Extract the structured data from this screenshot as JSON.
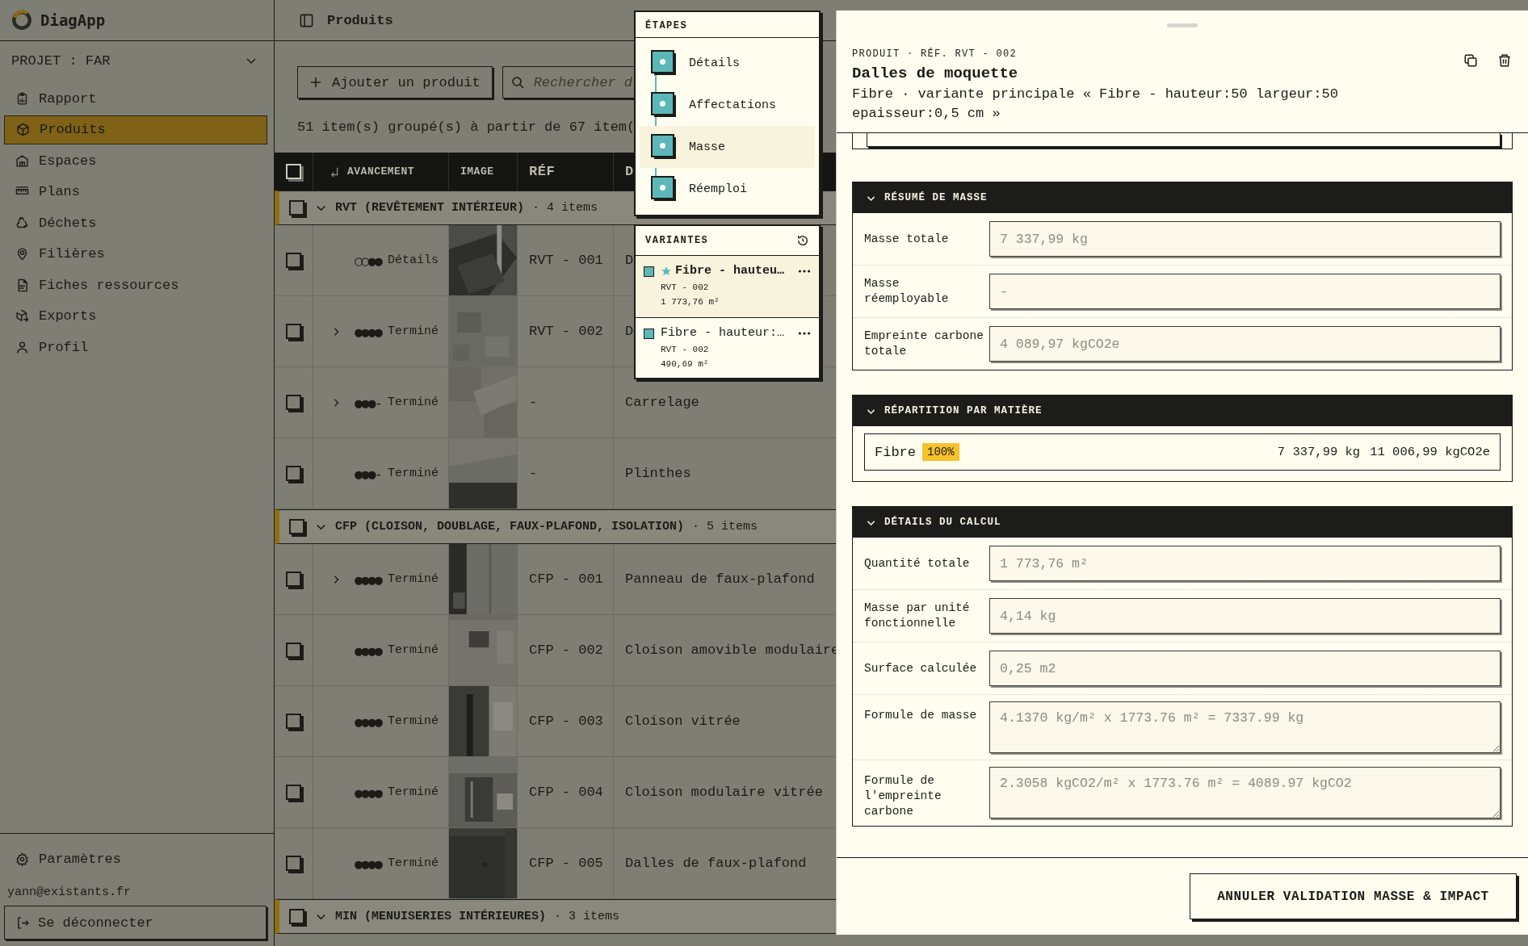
{
  "app": {
    "name": "DiagApp"
  },
  "sidebar": {
    "project": "PROJET : FAR",
    "items": [
      {
        "label": "Rapport",
        "selected": false
      },
      {
        "label": "Produits",
        "selected": true
      },
      {
        "label": "Espaces",
        "selected": false
      },
      {
        "label": "Plans",
        "selected": false
      },
      {
        "label": "Déchets",
        "selected": false
      },
      {
        "label": "Filières",
        "selected": false
      },
      {
        "label": "Fiches ressources",
        "selected": false
      },
      {
        "label": "Exports",
        "selected": false
      },
      {
        "label": "Profil",
        "selected": false
      }
    ],
    "settings": "Paramètres",
    "user_email": "yann@existants.fr",
    "logout": "Se déconnecter"
  },
  "topbar": {
    "title": "Produits"
  },
  "toolbar": {
    "add_button": "Ajouter un produit",
    "search": {
      "placeholder": "Rechercher d"
    }
  },
  "summary": "51 item(s) groupé(s) à partir de 67 item(",
  "table": {
    "all_checked": false,
    "columns": [
      "AVANCEMENT",
      "IMAGE",
      "RÉF",
      "D"
    ],
    "groups": [
      {
        "label": "RVT (REVÊTEMENT INTÉRIEUR)",
        "count": "· 4 items",
        "expanded": true,
        "checked": false,
        "rows": [
          {
            "checked": false,
            "expandable": false,
            "progress": "○○●●",
            "status": "Détails",
            "ref": "RVT - 001",
            "description": "D"
          },
          {
            "checked": false,
            "expandable": true,
            "progress": "●●●●",
            "status": "Terminé",
            "ref": "RVT - 002",
            "description": "D"
          },
          {
            "checked": false,
            "expandable": true,
            "progress": "●●●-",
            "status": "Terminé",
            "ref": "-",
            "description": "Carrelage"
          },
          {
            "checked": false,
            "expandable": false,
            "progress": "●●●-",
            "status": "Terminé",
            "ref": "-",
            "description": "Plinthes"
          }
        ]
      },
      {
        "label": "CFP (CLOISON, DOUBLAGE, FAUX-PLAFOND, ISOLATION)",
        "count": "· 5 items",
        "expanded": true,
        "checked": false,
        "rows": [
          {
            "checked": false,
            "expandable": true,
            "progress": "●●●●",
            "status": "Terminé",
            "ref": "CFP - 001",
            "description": "Panneau de faux-plafond"
          },
          {
            "checked": false,
            "expandable": false,
            "progress": "●●●●",
            "status": "Terminé",
            "ref": "CFP - 002",
            "description": "Cloison amovible modulaire"
          },
          {
            "checked": false,
            "expandable": false,
            "progress": "●●●●",
            "status": "Terminé",
            "ref": "CFP - 003",
            "description": "Cloison vitrée"
          },
          {
            "checked": false,
            "expandable": false,
            "progress": "●●●●",
            "status": "Terminé",
            "ref": "CFP - 004",
            "description": "Cloison modulaire vitrée"
          },
          {
            "checked": false,
            "expandable": false,
            "progress": "●●●●",
            "status": "Terminé",
            "ref": "CFP - 005",
            "description": "Dalles de faux-plafond"
          }
        ]
      },
      {
        "label": "MIN (MENUISERIES INTÉRIEURES)",
        "count": "· 3 items",
        "expanded": true,
        "checked": false
      }
    ]
  },
  "steps_popup": {
    "title": "ÉTAPES",
    "steps": [
      {
        "label": "Détails",
        "selected": false
      },
      {
        "label": "Affectations",
        "selected": false
      },
      {
        "label": "Masse",
        "selected": true
      },
      {
        "label": "Réemploi",
        "selected": false
      }
    ]
  },
  "variants_popup": {
    "title": "VARIANTES",
    "items": [
      {
        "name": "Fibre - hauteu…",
        "principal": true,
        "selected": true,
        "ref": "RVT - 002",
        "quantity": "1 773,76 m²"
      },
      {
        "name": "Fibre - hauteur:…",
        "principal": false,
        "selected": false,
        "ref": "RVT - 002",
        "quantity": "490,69 m²"
      }
    ]
  },
  "drawer": {
    "eyebrow": "PRODUIT · RÉF. RVT - 002",
    "title": "Dalles de moquette",
    "subtitle": "Fibre · variante principale « Fibre - hauteur:50 largeur:50 epaisseur:0,5 cm »",
    "sections": [
      {
        "kind": "fields",
        "title": "RÉSUMÉ DE MASSE",
        "expanded": true,
        "fields": [
          {
            "kind": "input",
            "label": "Masse totale",
            "value": "7 337,99 kg"
          },
          {
            "kind": "input",
            "label": "Masse réemployable",
            "value": "-"
          },
          {
            "kind": "input",
            "label": "Empreinte carbone totale",
            "value": "4 089,97 kgCO2e"
          }
        ]
      },
      {
        "kind": "materials",
        "title": "RÉPARTITION PAR MATIÈRE",
        "expanded": true,
        "materials": [
          {
            "name": "Fibre",
            "share": "100%",
            "mass": "7 337,99 kg",
            "carbon": "11 006,99 kgCO2e"
          }
        ]
      },
      {
        "kind": "fields",
        "title": "DÉTAILS DU CALCUL",
        "expanded": true,
        "fields": [
          {
            "kind": "input",
            "label": "Quantité totale",
            "value": "1 773,76 m²"
          },
          {
            "kind": "input",
            "label": "Masse par unité fonctionnelle",
            "value": "4,14 kg"
          },
          {
            "kind": "input",
            "label": "Surface calculée",
            "value": "0,25 m2"
          },
          {
            "kind": "textarea",
            "label": "Formule de masse",
            "value": "4.1370 kg/m² x 1773.76 m² = 7337.99 kg"
          },
          {
            "kind": "textarea",
            "label": "Formule de l'empreinte carbone",
            "value": "2.3058 kgCO2/m² x 1773.76 m² = 4089.97 kgCO2"
          }
        ]
      }
    ],
    "footer_button": "ANNULER VALIDATION MASSE & IMPACT"
  }
}
